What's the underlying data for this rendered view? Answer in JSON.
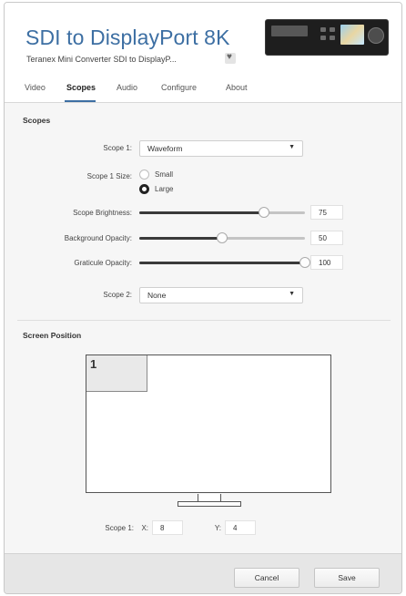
{
  "header": {
    "title": "SDI to DisplayPort 8K",
    "subtitle": "Teranex Mini Converter SDI to DisplayP..."
  },
  "tabs": [
    {
      "label": "Video",
      "active": false
    },
    {
      "label": "Scopes",
      "active": true
    },
    {
      "label": "Audio",
      "active": false
    },
    {
      "label": "Configure",
      "active": false
    },
    {
      "label": "About",
      "active": false
    }
  ],
  "scopes": {
    "heading": "Scopes",
    "scope1_label": "Scope 1:",
    "scope1_value": "Waveform",
    "size_label": "Scope 1 Size:",
    "size_options": [
      "Small",
      "Large"
    ],
    "size_selected": "Large",
    "brightness_label": "Scope Brightness:",
    "brightness_value": "75",
    "bg_opacity_label": "Background Opacity:",
    "bg_opacity_value": "50",
    "graticule_label": "Graticule Opacity:",
    "graticule_value": "100",
    "scope2_label": "Scope 2:",
    "scope2_value": "None"
  },
  "position": {
    "heading": "Screen Position",
    "scope_number": "1",
    "row_label": "Scope 1:",
    "x_label": "X:",
    "x_value": "8",
    "y_label": "Y:",
    "y_value": "4"
  },
  "footer": {
    "cancel_label": "Cancel",
    "save_label": "Save"
  }
}
